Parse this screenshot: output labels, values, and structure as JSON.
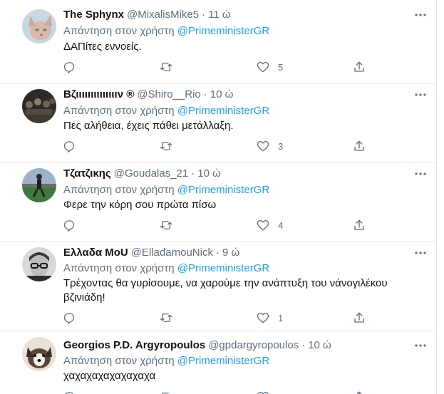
{
  "tweets": [
    {
      "name": "The Sphynx",
      "handle": "@MixalisMike5",
      "dot": "·",
      "time": "11 ώ",
      "reply_prefix": "Απάντηση στον χρήστη",
      "reply_to": "@PrimeministerGR",
      "text": "ΔΑΠίτες εννοείς.",
      "likes": "5",
      "avatar": "sphynx-cat-photo"
    },
    {
      "name": "Βζιιιιιιιιιιιιιιν ®",
      "handle": "@Shiro__Rio",
      "dot": "·",
      "time": "10 ώ",
      "reply_prefix": "Απάντηση στον χρήστη",
      "reply_to": "@PrimeministerGR",
      "text": "Πες αλήθεια, έχεις πάθει μετάλλαξη.",
      "likes": "3",
      "avatar": "dark-crowd-photo"
    },
    {
      "name": "Τζατζικης",
      "handle": "@Goudalas_21",
      "dot": "·",
      "time": "10 ώ",
      "reply_prefix": "Απάντηση στον χρήστη",
      "reply_to": "@PrimeministerGR",
      "text": "Φερε την κόρη σου πρώτα πίσω",
      "likes": "4",
      "avatar": "football-pitch-photo"
    },
    {
      "name": "Ελλαδα ΜοU",
      "handle": "@ElladamouNick",
      "dot": "·",
      "time": "9 ώ",
      "reply_prefix": "Απάντηση στον χρήστη",
      "reply_to": "@PrimeministerGR",
      "text": "Τρέχοντας θα γυρίσουμε, να χαρούμε την ανάπτυξη του νάνογιλέκου βζινιάδη!",
      "likes": "1",
      "avatar": "man-glasses-bw-photo"
    },
    {
      "name": "Georgios P.D. Argyropoulos",
      "handle": "@gpdargyropoulos",
      "dot": "·",
      "time": "10 ώ",
      "reply_prefix": "Απάντηση στον χρήστη",
      "reply_to": "@PrimeministerGR",
      "text": "χαχαχαχαχαχαχαχα",
      "likes": "",
      "avatar": "dog-photo"
    }
  ],
  "colors": {
    "link": "#1da1f2",
    "secondary_text": "#5b7083",
    "primary_text": "#0f1419",
    "divider": "#e6ecf0"
  },
  "icons": [
    "more-icon",
    "reply-icon",
    "retweet-icon",
    "like-icon",
    "share-icon"
  ]
}
